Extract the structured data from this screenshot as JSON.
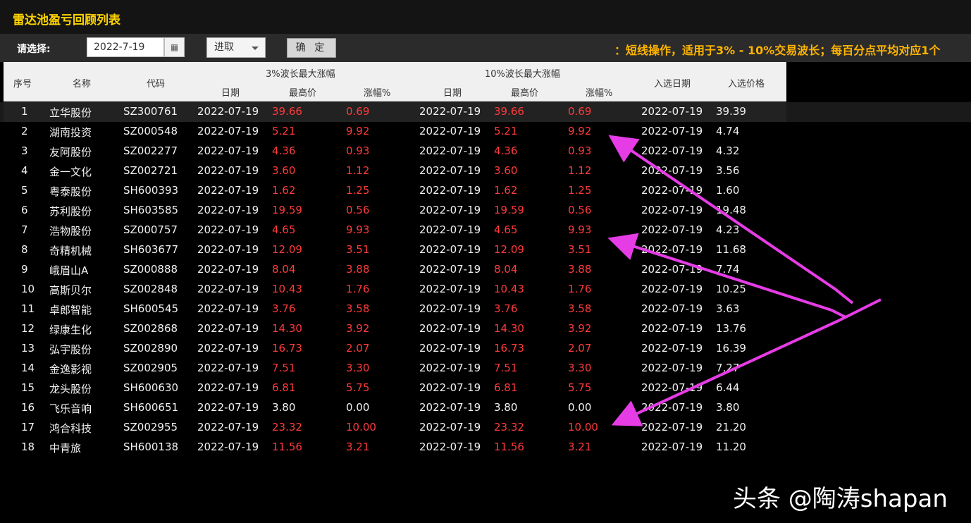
{
  "window": {
    "title": "雷达池盈亏回顾列表"
  },
  "toolbar": {
    "select_label": "请选择:",
    "date_value": "2022-7-19",
    "calendar_icon": "calendar-icon",
    "mode_value": "进取",
    "confirm_label": "确 定",
    "note": "：短线操作，适用于3% - 10%交易波长；每百分点平均对应1个"
  },
  "header": {
    "seq": "序号",
    "name": "名称",
    "code": "代码",
    "group3": "3%波长最大涨幅",
    "group10": "10%波长最大涨幅",
    "date": "日期",
    "high": "最高价",
    "pct": "涨幅%",
    "entry_date": "入选日期",
    "entry_price": "入选价格"
  },
  "rows": [
    {
      "seq": "1",
      "name": "立华股份",
      "code": "SZ300761",
      "d3": "2022-07-19",
      "h3": "39.66",
      "p3": "0.69",
      "d10": "2022-07-19",
      "h10": "39.66",
      "p10": "0.69",
      "ed": "2022-07-19",
      "ep": "39.39",
      "red": true
    },
    {
      "seq": "2",
      "name": "湖南投资",
      "code": "SZ000548",
      "d3": "2022-07-19",
      "h3": "5.21",
      "p3": "9.92",
      "d10": "2022-07-19",
      "h10": "5.21",
      "p10": "9.92",
      "ed": "2022-07-19",
      "ep": "4.74",
      "red": true
    },
    {
      "seq": "3",
      "name": "友阿股份",
      "code": "SZ002277",
      "d3": "2022-07-19",
      "h3": "4.36",
      "p3": "0.93",
      "d10": "2022-07-19",
      "h10": "4.36",
      "p10": "0.93",
      "ed": "2022-07-19",
      "ep": "4.32",
      "red": true
    },
    {
      "seq": "4",
      "name": "金一文化",
      "code": "SZ002721",
      "d3": "2022-07-19",
      "h3": "3.60",
      "p3": "1.12",
      "d10": "2022-07-19",
      "h10": "3.60",
      "p10": "1.12",
      "ed": "2022-07-19",
      "ep": "3.56",
      "red": true
    },
    {
      "seq": "5",
      "name": "粤泰股份",
      "code": "SH600393",
      "d3": "2022-07-19",
      "h3": "1.62",
      "p3": "1.25",
      "d10": "2022-07-19",
      "h10": "1.62",
      "p10": "1.25",
      "ed": "2022-07-19",
      "ep": "1.60",
      "red": true
    },
    {
      "seq": "6",
      "name": "苏利股份",
      "code": "SH603585",
      "d3": "2022-07-19",
      "h3": "19.59",
      "p3": "0.56",
      "d10": "2022-07-19",
      "h10": "19.59",
      "p10": "0.56",
      "ed": "2022-07-19",
      "ep": "19.48",
      "red": true
    },
    {
      "seq": "7",
      "name": "浩物股份",
      "code": "SZ000757",
      "d3": "2022-07-19",
      "h3": "4.65",
      "p3": "9.93",
      "d10": "2022-07-19",
      "h10": "4.65",
      "p10": "9.93",
      "ed": "2022-07-19",
      "ep": "4.23",
      "red": true
    },
    {
      "seq": "8",
      "name": "奇精机械",
      "code": "SH603677",
      "d3": "2022-07-19",
      "h3": "12.09",
      "p3": "3.51",
      "d10": "2022-07-19",
      "h10": "12.09",
      "p10": "3.51",
      "ed": "2022-07-19",
      "ep": "11.68",
      "red": true
    },
    {
      "seq": "9",
      "name": "峨眉山A",
      "code": "SZ000888",
      "d3": "2022-07-19",
      "h3": "8.04",
      "p3": "3.88",
      "d10": "2022-07-19",
      "h10": "8.04",
      "p10": "3.88",
      "ed": "2022-07-19",
      "ep": "7.74",
      "red": true
    },
    {
      "seq": "10",
      "name": "高斯贝尔",
      "code": "SZ002848",
      "d3": "2022-07-19",
      "h3": "10.43",
      "p3": "1.76",
      "d10": "2022-07-19",
      "h10": "10.43",
      "p10": "1.76",
      "ed": "2022-07-19",
      "ep": "10.25",
      "red": true
    },
    {
      "seq": "11",
      "name": "卓郎智能",
      "code": "SH600545",
      "d3": "2022-07-19",
      "h3": "3.76",
      "p3": "3.58",
      "d10": "2022-07-19",
      "h10": "3.76",
      "p10": "3.58",
      "ed": "2022-07-19",
      "ep": "3.63",
      "red": true
    },
    {
      "seq": "12",
      "name": "绿康生化",
      "code": "SZ002868",
      "d3": "2022-07-19",
      "h3": "14.30",
      "p3": "3.92",
      "d10": "2022-07-19",
      "h10": "14.30",
      "p10": "3.92",
      "ed": "2022-07-19",
      "ep": "13.76",
      "red": true
    },
    {
      "seq": "13",
      "name": "弘宇股份",
      "code": "SZ002890",
      "d3": "2022-07-19",
      "h3": "16.73",
      "p3": "2.07",
      "d10": "2022-07-19",
      "h10": "16.73",
      "p10": "2.07",
      "ed": "2022-07-19",
      "ep": "16.39",
      "red": true
    },
    {
      "seq": "14",
      "name": "金逸影视",
      "code": "SZ002905",
      "d3": "2022-07-19",
      "h3": "7.51",
      "p3": "3.30",
      "d10": "2022-07-19",
      "h10": "7.51",
      "p10": "3.30",
      "ed": "2022-07-19",
      "ep": "7.27",
      "red": true
    },
    {
      "seq": "15",
      "name": "龙头股份",
      "code": "SH600630",
      "d3": "2022-07-19",
      "h3": "6.81",
      "p3": "5.75",
      "d10": "2022-07-19",
      "h10": "6.81",
      "p10": "5.75",
      "ed": "2022-07-19",
      "ep": "6.44",
      "red": true
    },
    {
      "seq": "16",
      "name": "飞乐音响",
      "code": "SH600651",
      "d3": "2022-07-19",
      "h3": "3.80",
      "p3": "0.00",
      "d10": "2022-07-19",
      "h10": "3.80",
      "p10": "0.00",
      "ed": "2022-07-19",
      "ep": "3.80",
      "red": false
    },
    {
      "seq": "17",
      "name": "鸿合科技",
      "code": "SZ002955",
      "d3": "2022-07-19",
      "h3": "23.32",
      "p3": "10.00",
      "d10": "2022-07-19",
      "h10": "23.32",
      "p10": "10.00",
      "ed": "2022-07-19",
      "ep": "21.20",
      "red": true
    },
    {
      "seq": "18",
      "name": "中青旅",
      "code": "SH600138",
      "d3": "2022-07-19",
      "h3": "11.56",
      "p3": "3.21",
      "d10": "2022-07-19",
      "h10": "11.56",
      "p10": "3.21",
      "ed": "2022-07-19",
      "ep": "11.20",
      "red": true
    }
  ],
  "colors": {
    "title": "#ffd400",
    "note": "#ffb400",
    "up": "#ff3b3b",
    "arrow": "#e63ce6"
  },
  "watermark": "头条 @陶涛shapan"
}
